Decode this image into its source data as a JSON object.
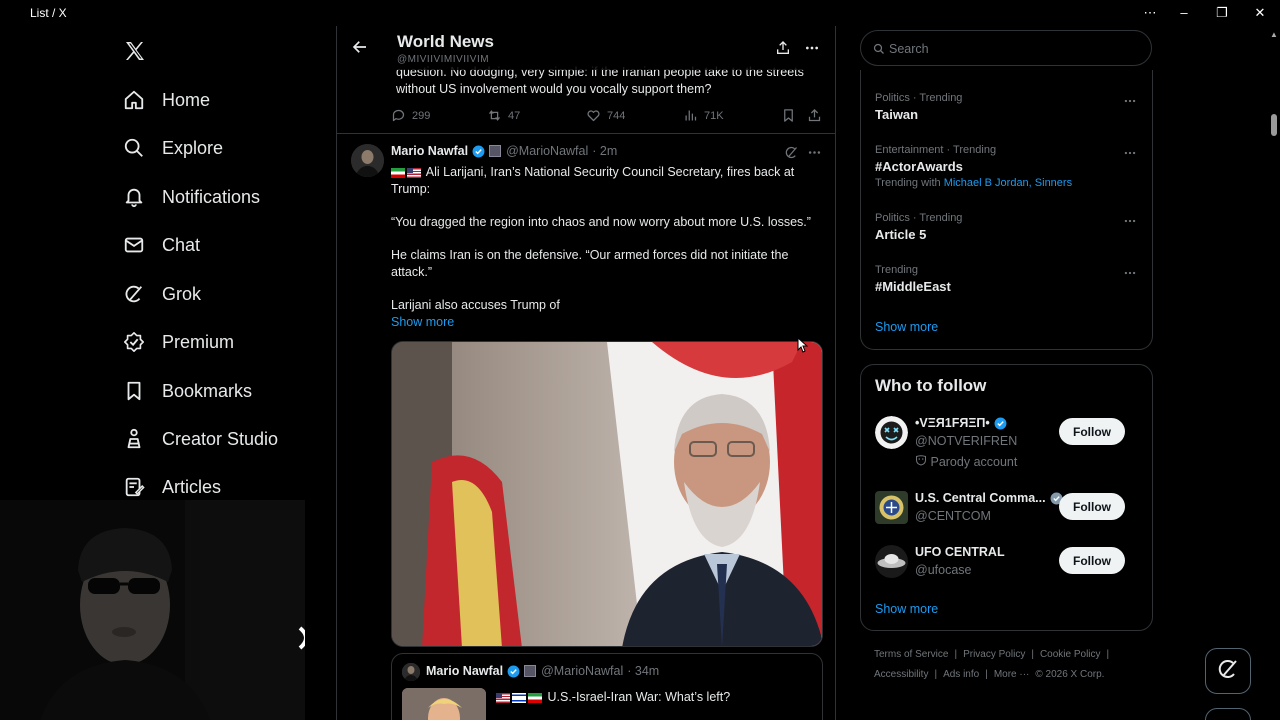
{
  "window": {
    "title": "List / X",
    "controls": {
      "more": "⋯",
      "minimize": "–",
      "restore": "❐",
      "close": "✕"
    }
  },
  "nav": {
    "items": [
      {
        "label": "Home",
        "icon": "home-icon"
      },
      {
        "label": "Explore",
        "icon": "search-icon"
      },
      {
        "label": "Notifications",
        "icon": "bell-icon"
      },
      {
        "label": "Chat",
        "icon": "mail-icon"
      },
      {
        "label": "Grok",
        "icon": "grok-icon"
      },
      {
        "label": "Premium",
        "icon": "premium-icon"
      },
      {
        "label": "Bookmarks",
        "icon": "bookmark-icon"
      },
      {
        "label": "Creator Studio",
        "icon": "creator-studio-icon"
      },
      {
        "label": "Articles",
        "icon": "articles-icon"
      }
    ]
  },
  "list_header": {
    "title": "World News",
    "subtitle": "@MIVIIVIMIVIIVIM"
  },
  "prev_tweet": {
    "text": "question. No dodging, very simple: if the Iranian people take to the streets without US involvement would you vocally support them?",
    "replies": "299",
    "reposts": "47",
    "likes": "744",
    "views": "71K"
  },
  "tweet": {
    "name": "Mario Nawfal",
    "handle": "@MarioNawfal",
    "time": "· 2m",
    "line1": "Ali Larijani, Iran’s National Security Council Secretary, fires back at Trump:",
    "line2": "“You dragged the region into chaos and now worry about more U.S. losses.”",
    "line3": "He claims Iran is on the defensive. “Our armed forces did not initiate the attack.”",
    "line4": "Larijani also accuses Trump of",
    "show_more": "Show more"
  },
  "quote": {
    "name": "Mario Nawfal",
    "handle": "@MarioNawfal",
    "time": "· 34m",
    "text": "U.S.-Israel-Iran War: What’s left?"
  },
  "search": {
    "placeholder": "Search"
  },
  "trends": [
    {
      "meta": "Politics · Trending",
      "name": "Taiwan"
    },
    {
      "meta": "Entertainment · Trending",
      "name": "#ActorAwards",
      "with_prefix": "Trending with",
      "with_links": "Michael B Jordan, Sinners"
    },
    {
      "meta": "Politics · Trending",
      "name": "Article 5"
    },
    {
      "meta": "Trending",
      "name": "#MiddleEast"
    }
  ],
  "trends_show_more": "Show more",
  "who_to_follow": {
    "title": "Who to follow",
    "accounts": [
      {
        "name": "•VΞЯ1FЯΞΠ•",
        "handle": "@NOTVERIFREN",
        "note": "Parody account",
        "button": "Follow"
      },
      {
        "name": "U.S. Central Comma...",
        "handle": "@CENTCOM",
        "button": "Follow"
      },
      {
        "name": "UFO CENTRAL",
        "handle": "@ufocase",
        "button": "Follow"
      }
    ],
    "show_more": "Show more"
  },
  "footer": {
    "links": [
      "Terms of Service",
      "Privacy Policy",
      "Cookie Policy",
      "Accessibility",
      "Ads info",
      "More ···"
    ],
    "copyright": "© 2026 X Corp."
  },
  "colors": {
    "accent": "#1d9bf0",
    "background": "#000000",
    "border": "#2f3336",
    "muted": "#71767b"
  }
}
